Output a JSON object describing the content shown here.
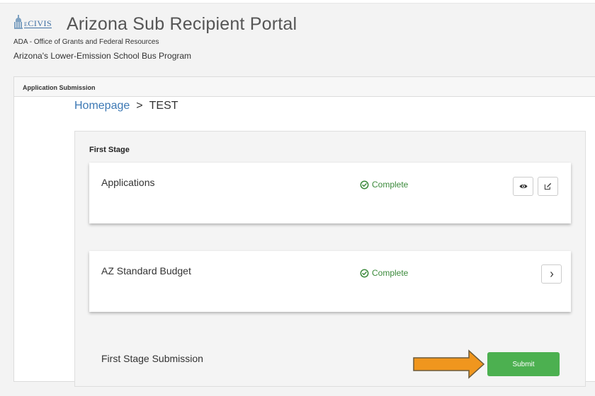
{
  "header": {
    "logo_text": "eCIVIS",
    "title": "Arizona Sub Recipient Portal",
    "org": "ADA - Office of Grants and Federal Resources",
    "program": "Arizona's Lower-Emission School Bus Program"
  },
  "panel": {
    "heading": "Application Submission"
  },
  "breadcrumb": {
    "home": "Homepage",
    "separator": ">",
    "current": "TEST"
  },
  "stage": {
    "title": "First Stage",
    "tasks": [
      {
        "name": "Applications",
        "status": "Complete",
        "actions": [
          "eye-icon",
          "edit-icon"
        ]
      },
      {
        "name": "AZ Standard Budget",
        "status": "Complete",
        "actions": [
          "chevron-right-icon"
        ]
      }
    ],
    "submission_label": "First Stage Submission",
    "submit_label": "Submit"
  },
  "colors": {
    "status_complete": "#3b8a3b",
    "submit_button": "#4cb050",
    "link": "#3c78b4",
    "annotation_arrow": "#f0961e"
  }
}
